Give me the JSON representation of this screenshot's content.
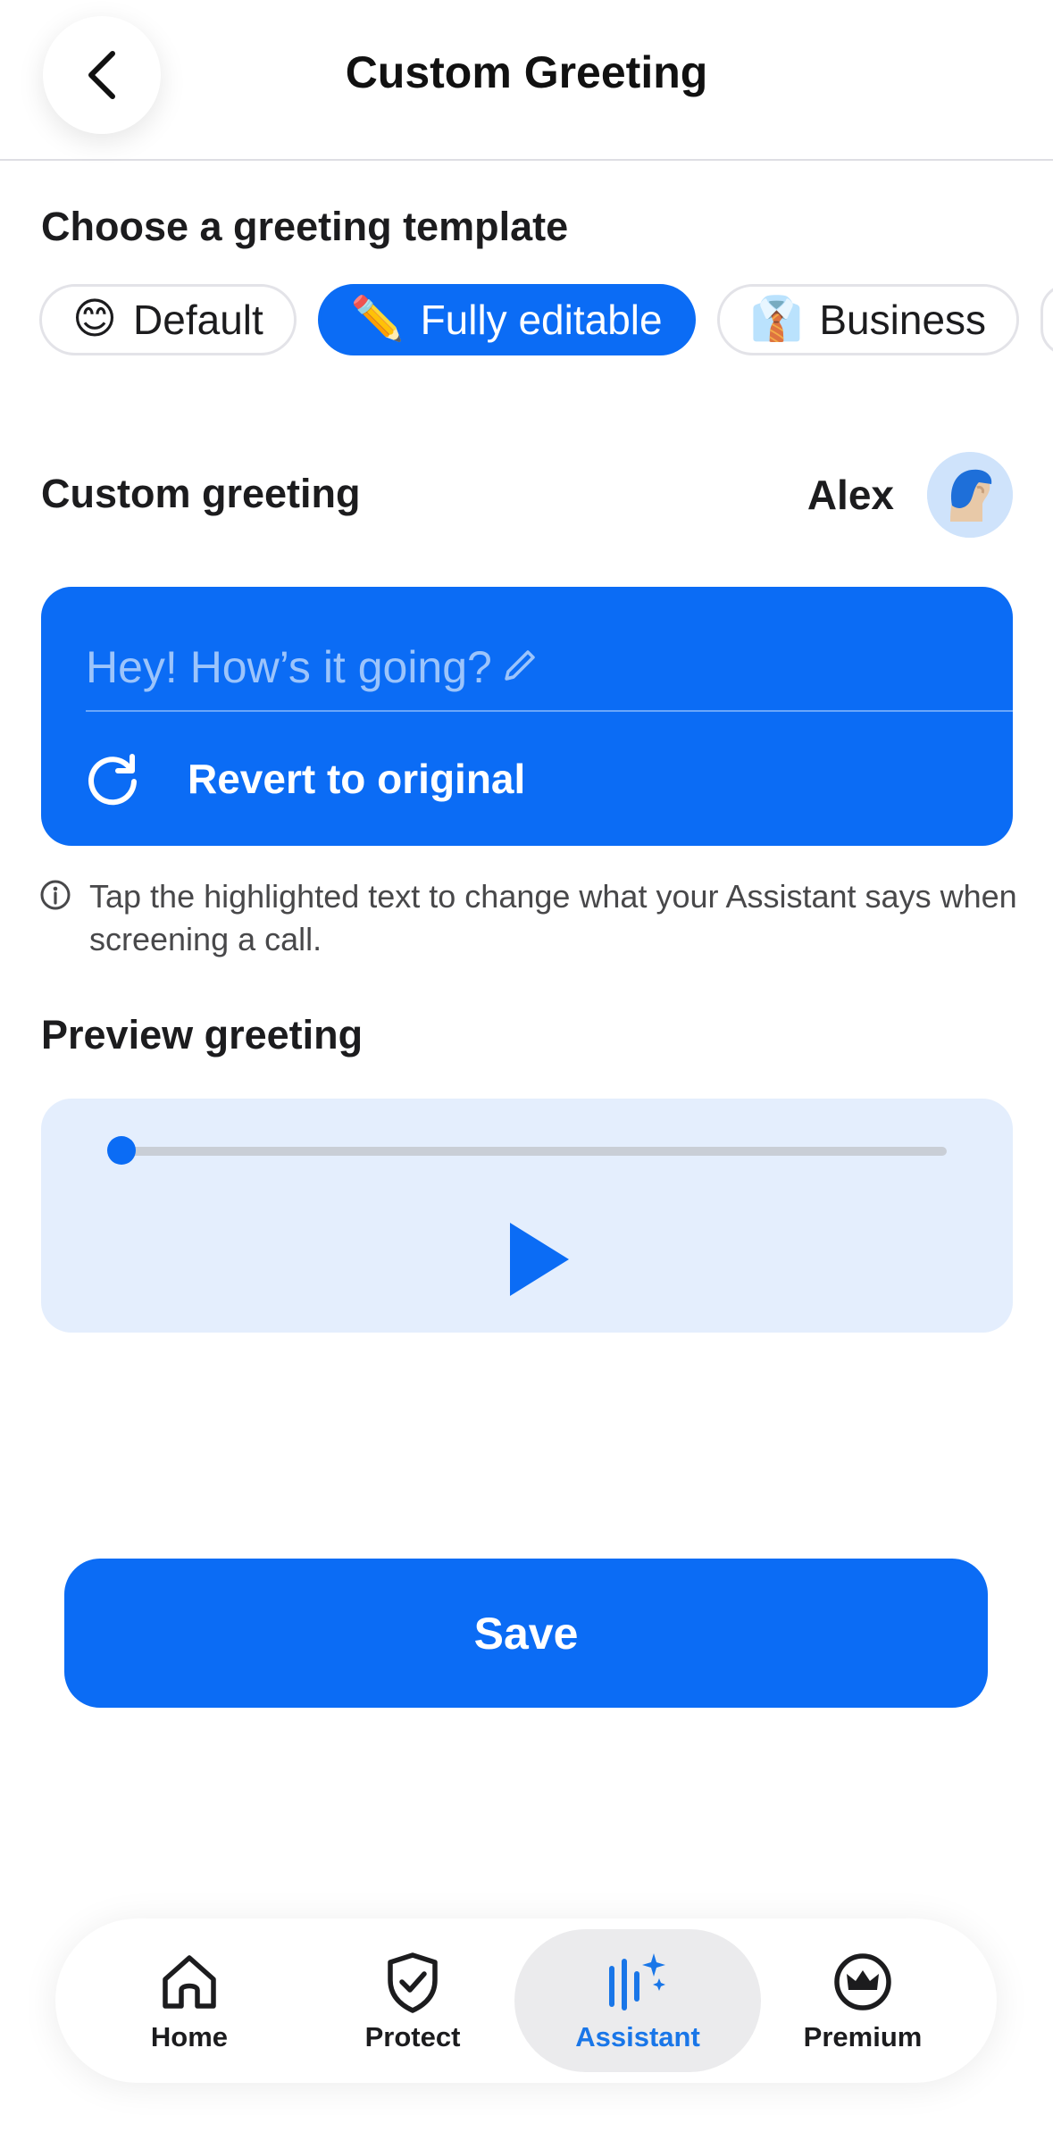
{
  "header": {
    "title": "Custom Greeting",
    "back_icon": "chevron-left-icon"
  },
  "templates": {
    "heading": "Choose a greeting template",
    "items": [
      {
        "emoji": "😊",
        "label": "Default",
        "selected": false
      },
      {
        "emoji": "✏️",
        "label": "Fully editable",
        "selected": true
      },
      {
        "emoji": "👔",
        "label": "Business",
        "selected": false
      }
    ]
  },
  "custom_greeting": {
    "heading": "Custom greeting",
    "user_name": "Alex",
    "greeting_text": "Hey! How’s it going?",
    "revert_label": "Revert to original",
    "info_text": "Tap the highlighted text to change what your Assistant says when screening a call."
  },
  "preview": {
    "heading": "Preview greeting",
    "progress": 0
  },
  "save_label": "Save",
  "nav": {
    "items": [
      {
        "label": "Home",
        "icon": "home-icon",
        "active": false
      },
      {
        "label": "Protect",
        "icon": "shield-check-icon",
        "active": false
      },
      {
        "label": "Assistant",
        "icon": "assistant-sparkle-icon",
        "active": true
      },
      {
        "label": "Premium",
        "icon": "crown-icon",
        "active": false
      }
    ]
  },
  "colors": {
    "accent": "#0b6cf5",
    "accent_light": "#e4eefd",
    "nav_active_bg": "#ebebed"
  }
}
